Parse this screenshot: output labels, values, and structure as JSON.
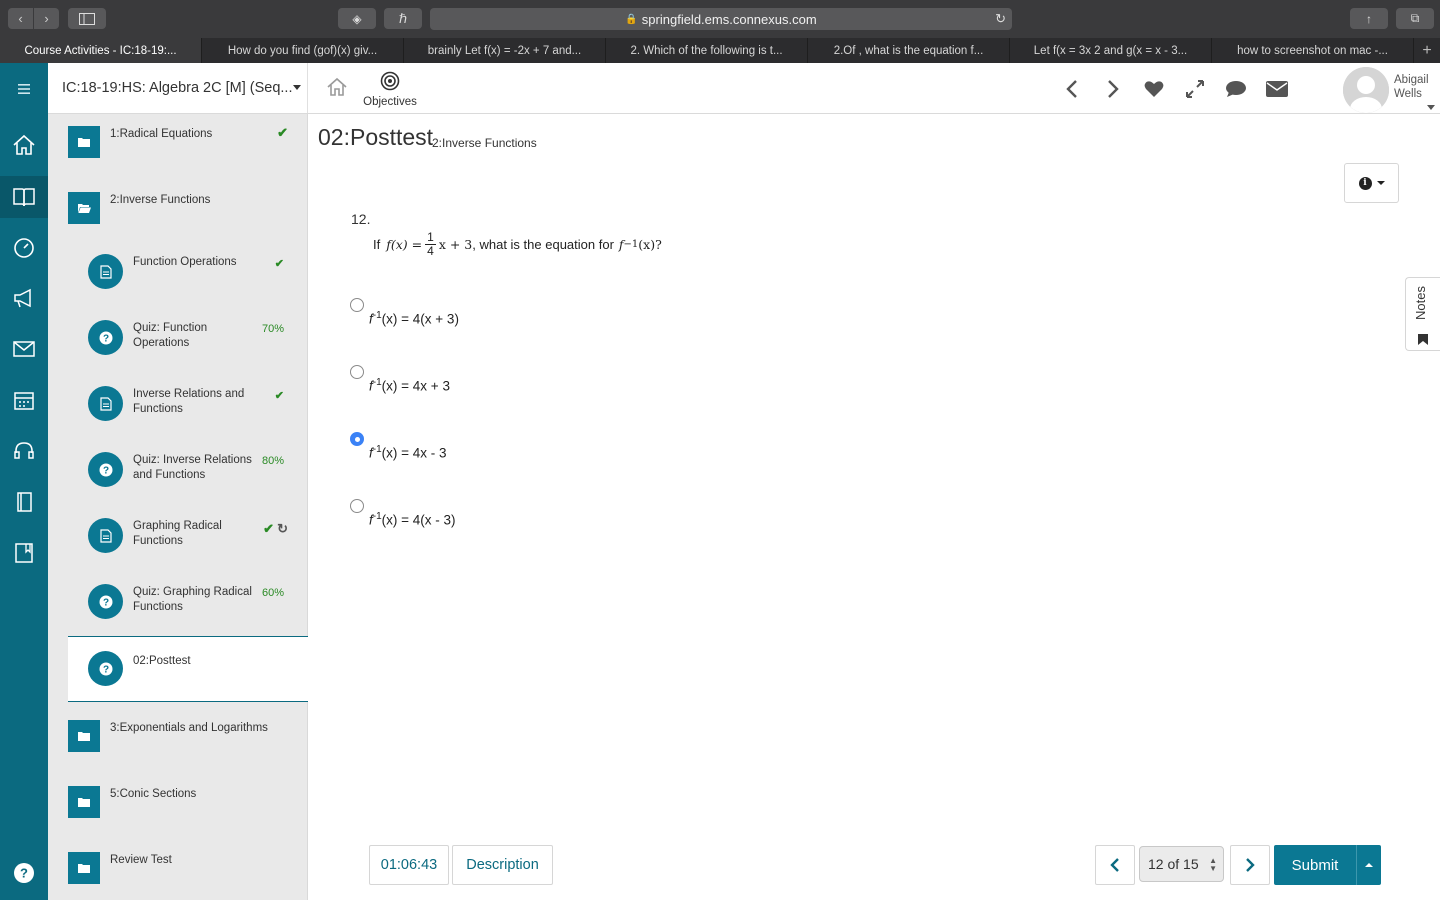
{
  "browser": {
    "url": "springfield.ems.connexus.com",
    "tabs": [
      {
        "label": "Course Activities - IC:18-19:...",
        "active": true
      },
      {
        "label": "How do you find (gof)(x) giv...",
        "active": false
      },
      {
        "label": "brainly Let f(x) = -2x + 7 and...",
        "active": false
      },
      {
        "label": "2. Which of the following is t...",
        "active": false
      },
      {
        "label": "2.Of , what is the equation f...",
        "active": false
      },
      {
        "label": "Let f(x = 3x 2 and g(x = x - 3...",
        "active": false
      },
      {
        "label": "how to screenshot on mac -...",
        "active": false
      }
    ],
    "new_tab": "+"
  },
  "header": {
    "course": "IC:18-19:HS: Algebra 2C [M] (Seq...",
    "objectives_label": "Objectives",
    "user_first": "Abigail",
    "user_last": "Wells"
  },
  "sidebar": {
    "items": [
      {
        "label": "1:Radical Equations",
        "status": "✔"
      },
      {
        "label": "2:Inverse Functions",
        "status": ""
      },
      {
        "label": "Function Operations",
        "status": "✔"
      },
      {
        "label_1": "Quiz: Function",
        "label_2": "Operations",
        "status": "70%"
      },
      {
        "label_1": "Inverse Relations and",
        "label_2": "Functions",
        "status": "✔"
      },
      {
        "label_1": "Quiz: Inverse Relations",
        "label_2": "and Functions",
        "status": "80%"
      },
      {
        "label_1": "Graphing Radical",
        "label_2": "Functions",
        "status": "✔"
      },
      {
        "label_1": "Quiz: Graphing Radical",
        "label_2": "Functions",
        "status": "60%"
      },
      {
        "label": "02:Posttest",
        "status": ""
      },
      {
        "label": "3:Exponentials and Logarithms",
        "status": ""
      },
      {
        "label": "5:Conic Sections",
        "status": ""
      },
      {
        "label": "Review Test",
        "status": ""
      }
    ]
  },
  "main": {
    "title": "02:Posttest",
    "subtitle": "2:Inverse Functions",
    "question_number": "12.",
    "question": {
      "prefix": "If",
      "fx": "f(x) =",
      "frac_num": "1",
      "frac_den": "4",
      "rest": "x + 3",
      "mid": ", what is the equation for",
      "finv": "f",
      "sup": "−1",
      "end": "(x)?"
    },
    "options": [
      {
        "f": "f",
        "sup": "-1",
        "expr": "(x) = 4(x + 3)",
        "selected": false
      },
      {
        "f": "f",
        "sup": "-1",
        "expr": "(x) = 4x + 3",
        "selected": false
      },
      {
        "f": "f",
        "sup": "-1",
        "expr": "(x) = 4x - 3",
        "selected": true
      },
      {
        "f": "f",
        "sup": "-1",
        "expr": "(x) = 4(x - 3)",
        "selected": false
      }
    ],
    "notes_label": "Notes"
  },
  "footer": {
    "timer": "01:06:43",
    "description": "Description",
    "pager": "12 of 15",
    "submit": "Submit"
  },
  "colors": {
    "brand": "#0b7893",
    "rail": "#0b6a80",
    "success": "#2a8a25",
    "radio_selected": "#3b82f6"
  }
}
